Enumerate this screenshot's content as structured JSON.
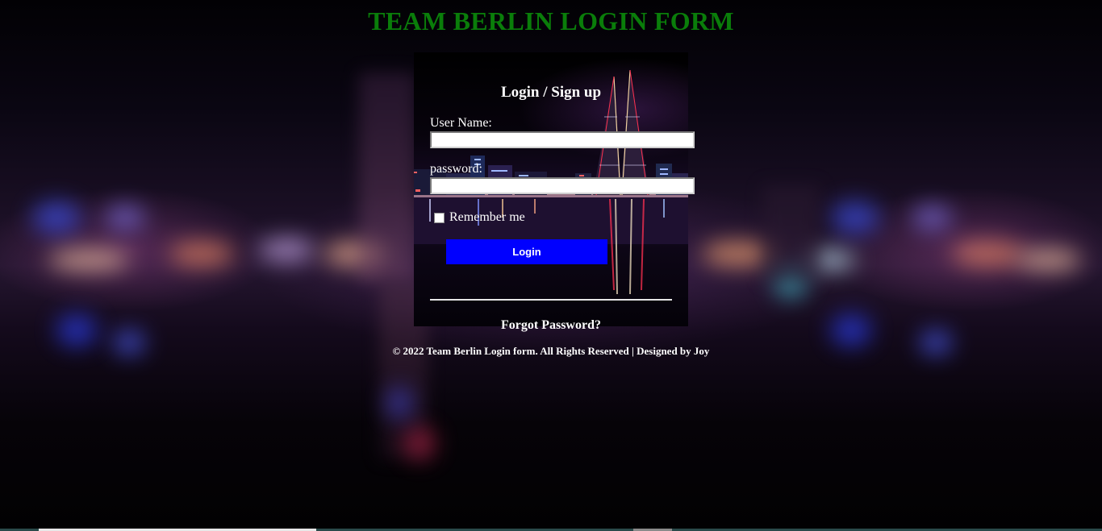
{
  "header": {
    "title": "TEAM BERLIN LOGIN FORM"
  },
  "form": {
    "heading": "Login / Sign up",
    "username_label": "User Name:",
    "username_value": "",
    "password_label": "password:",
    "password_value": "",
    "remember_label": "Remember me",
    "remember_checked": false,
    "login_label": "Login",
    "forgot_label": "Forgot Password?"
  },
  "footer": {
    "text": "© 2022 Team Berlin Login form. All Rights Reserved | Designed by Joy"
  },
  "colors": {
    "title": "#0a7d0a",
    "login_button": "#0000ff",
    "card_background": "#000000",
    "text": "#ffffff"
  }
}
